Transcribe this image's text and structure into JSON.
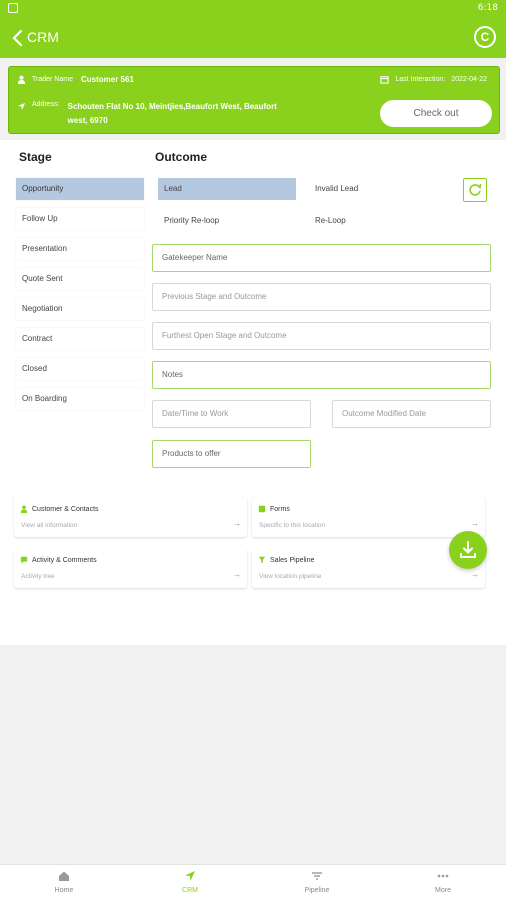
{
  "status_bar": {
    "time": "6:18"
  },
  "app_bar": {
    "title": "CRM",
    "right_icon": "C"
  },
  "header": {
    "trader_label": "Trader Name",
    "trader_name": "Customer 561",
    "last_interaction_label": "Last Interaction:",
    "last_interaction_date": "2022-04-22",
    "address_label": "Address:",
    "address": "Schouten Flat No 10, Meintjies,Beaufort West, Beaufort west, 6970",
    "checkout_label": "Check out"
  },
  "stage": {
    "title": "Stage",
    "items": [
      "Opportunity",
      "Follow Up",
      "Presentation",
      "Quote Sent",
      "Negotiation",
      "Contract",
      "Closed",
      "On Boarding"
    ],
    "selected": "Opportunity"
  },
  "outcome": {
    "title": "Outcome",
    "items": [
      "Lead",
      "Invalid Lead",
      "Priority Re-loop",
      "Re-Loop"
    ],
    "selected": "Lead"
  },
  "fields": {
    "gatekeeper": "Gatekeeper Name",
    "previous": "Previous Stage and Outcome",
    "furthest": "Furthest Open Stage and Outcome",
    "notes": "Notes",
    "datetime": "Date/Time to Work",
    "modified": "Outcome Modified Date",
    "products": "Products to offer"
  },
  "links": [
    {
      "title": "Customer & Contacts",
      "subtitle": "View all information",
      "icon": "person-icon"
    },
    {
      "title": "Forms",
      "subtitle": "Specific to this location",
      "icon": "form-icon"
    },
    {
      "title": "Activity & Comments",
      "subtitle": "Activity tree",
      "icon": "comment-icon"
    },
    {
      "title": "Sales Pipeline",
      "subtitle": "View location pipeline",
      "icon": "funnel-icon"
    }
  ],
  "bottom_nav": [
    {
      "label": "Home",
      "icon": "home-icon"
    },
    {
      "label": "CRM",
      "icon": "navigation-icon"
    },
    {
      "label": "Pipeline",
      "icon": "filter-icon"
    },
    {
      "label": "More",
      "icon": "more-icon"
    }
  ],
  "colors": {
    "accent": "#8ad11e",
    "selected": "#b4c8e0"
  }
}
